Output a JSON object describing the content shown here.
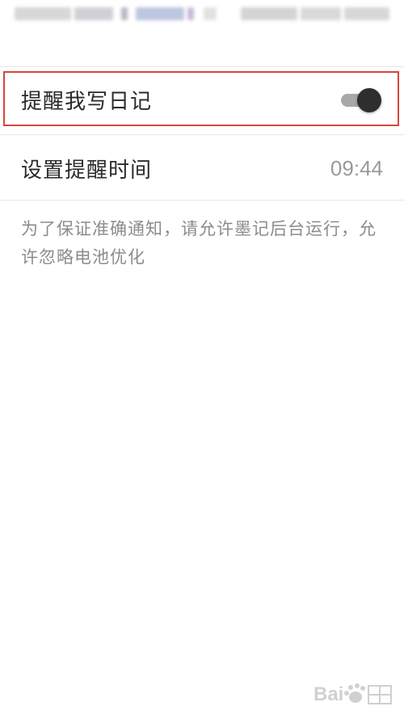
{
  "statusbar": {
    "blocks": [
      {
        "color": "#d7d7d7"
      },
      {
        "color": "#cfcfd6"
      },
      {
        "color": "#d9d9d9"
      },
      {
        "color": "#b9b9c4"
      },
      {
        "color": "#bcc6e0"
      },
      {
        "color": "#c8b8d8"
      },
      {
        "color": "#e2e2e2"
      },
      {
        "color": "#d4d4d4"
      },
      {
        "color": "#d9d9d9"
      }
    ]
  },
  "settings": {
    "reminder_toggle": {
      "label": "提醒我写日记",
      "enabled": true,
      "icon": "toggle-switch-icon"
    },
    "reminder_time": {
      "label": "设置提醒时间",
      "value": "09:44"
    }
  },
  "hint_text": "为了保证准确通知，请允许墨记后台运行，允许忽略电池优化",
  "colors": {
    "highlight": "#d9453b",
    "thumb": "#2e2e2e",
    "track": "#a8a8a8"
  },
  "watermark": {
    "icon": "baidu-paw-logo-icon"
  }
}
